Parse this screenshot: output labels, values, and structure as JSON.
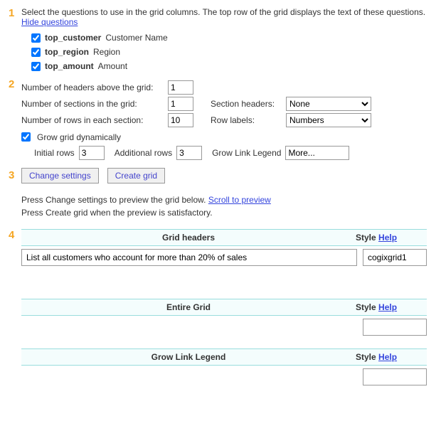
{
  "markers": {
    "m1": "1",
    "m2": "2",
    "m3": "3",
    "m4": "4"
  },
  "step1": {
    "intro": "Select the questions to use in the grid columns. The top row of the grid displays the text of these questions.",
    "hide_link": "Hide questions",
    "q1": {
      "code": "top_customer",
      "label": "Customer Name"
    },
    "q2": {
      "code": "top_region",
      "label": "Region"
    },
    "q3": {
      "code": "top_amount",
      "label": "Amount"
    }
  },
  "step2": {
    "num_headers_label": "Number of headers above the grid:",
    "num_headers_val": "1",
    "num_sections_label": "Number of sections in the grid:",
    "num_sections_val": "1",
    "section_headers_label": "Section headers:",
    "section_headers_val": "None",
    "num_rows_label": "Number of rows in each section:",
    "num_rows_val": "10",
    "row_labels_label": "Row labels:",
    "row_labels_val": "Numbers",
    "grow_label": "Grow grid dynamically",
    "initial_rows_label": "Initial rows",
    "initial_rows_val": "3",
    "additional_rows_label": "Additional rows",
    "additional_rows_val": "3",
    "grow_link_label": "Grow Link Legend",
    "grow_link_val": "More..."
  },
  "buttons": {
    "change": "Change settings",
    "create": "Create grid"
  },
  "info": {
    "line1a": "Press Change settings to preview the grid below.  ",
    "scroll_link": "Scroll to preview",
    "line2": "Press Create grid when the preview is satisfactory."
  },
  "sections": {
    "style_label": "Style",
    "help_link": "Help",
    "grid_headers": {
      "title": "Grid headers",
      "text_val": "List all customers who account for more than 20% of sales",
      "style_val": "cogixgrid1"
    },
    "entire_grid": {
      "title": "Entire Grid",
      "style_val": ""
    },
    "grow_link": {
      "title": "Grow Link Legend",
      "style_val": ""
    }
  }
}
